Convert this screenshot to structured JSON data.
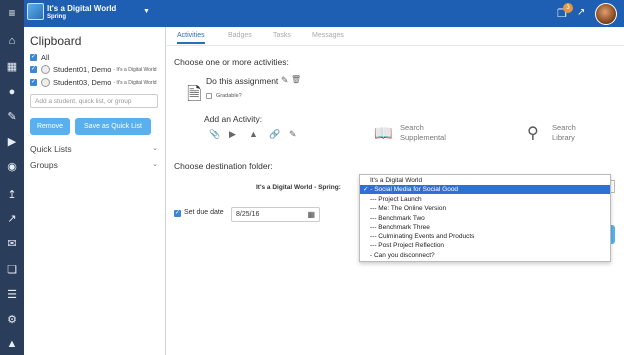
{
  "topbar": {
    "class_title": "It's a Digital World",
    "class_subtitle": "Spring",
    "notification_count": "3"
  },
  "rail": {
    "icons": [
      "menu-icon",
      "home-icon",
      "calendar-icon",
      "users-icon",
      "edit-icon",
      "play-icon",
      "palette-icon",
      "upload-icon",
      "chart-icon",
      "mail-icon",
      "pages-icon",
      "list-icon",
      "settings-icon",
      "alert-icon"
    ]
  },
  "clipboard": {
    "title": "Clipboard",
    "all_label": "All",
    "students": [
      {
        "name": "Student01, Demo",
        "note": "- It's a Digital World"
      },
      {
        "name": "Student03, Demo",
        "note": "- It's a Digital World"
      }
    ],
    "add_placeholder": "Add a student, quick list, or group",
    "remove_label": "Remove",
    "save_quicklist_label": "Save as Quick List",
    "quick_lists_label": "Quick Lists",
    "groups_label": "Groups"
  },
  "tabs": [
    "Activities",
    "Badges",
    "Tasks",
    "Messages"
  ],
  "main": {
    "choose_label": "Choose one or more activities:",
    "assignment_label": "Do this assignment",
    "gradable_label": "Gradable?",
    "add_activity_label": "Add an Activity:",
    "search_supplemental": [
      "Search",
      "Supplemental"
    ],
    "search_library": [
      "Search",
      "Library"
    ],
    "destination_label": "Choose destination folder:",
    "folder_context": "It's a Digital World - Spring:",
    "set_due_date_label": "Set due date",
    "due_date_value": "8/25/16"
  },
  "dropdown": {
    "options": [
      "It's a Digital World",
      "✓ - Social Media for Social Good",
      "--- Project Launch",
      "--- Me: The Online Version",
      "--- Benchmark Two",
      "--- Benchmark Three",
      "--- Culminating Events and Products",
      "--- Post Project Reflection",
      "- Can you disconnect?"
    ],
    "selected_index": 1
  },
  "colors": {
    "topbar": "#1e5fb3",
    "rail": "#2a3e5c",
    "accent": "#58b0ee",
    "selected": "#2f70d8"
  }
}
